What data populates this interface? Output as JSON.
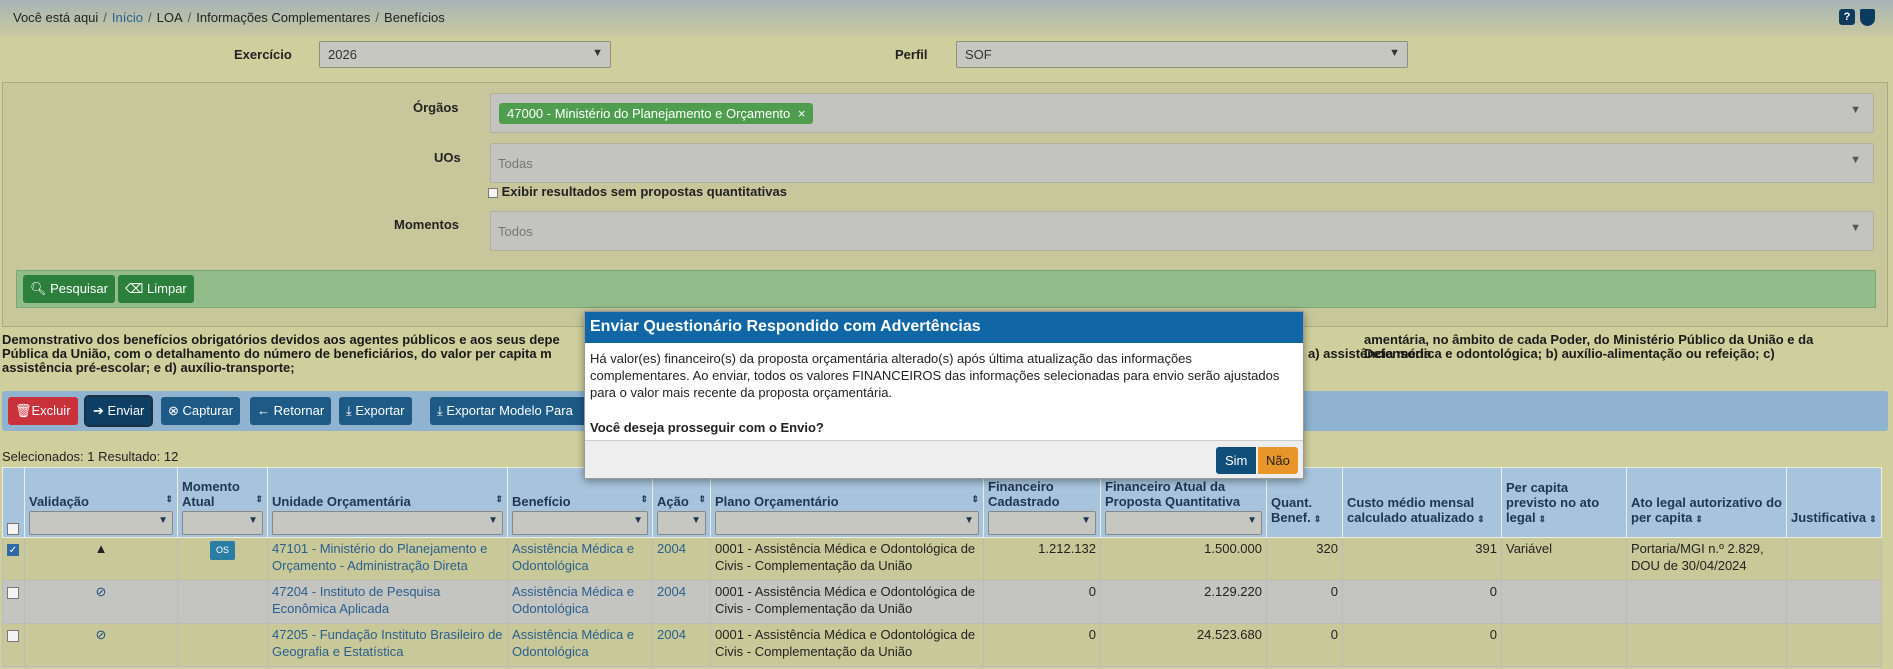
{
  "breadcrumb": {
    "prefix": "Você está aqui",
    "items": [
      "Início",
      "LOA",
      "Informações Complementares",
      "Benefícios"
    ]
  },
  "top_icons": {
    "help": "?",
    "shield": "shield-icon"
  },
  "filters": {
    "exercicio_label": "Exercício",
    "exercicio_value": "2026",
    "perfil_label": "Perfil",
    "perfil_value": "SOF",
    "orgaos_label": "Órgãos",
    "orgaos_tag": "47000 - Ministério do Planejamento e Orçamento",
    "uos_label": "UOs",
    "uos_placeholder": "Todas",
    "exibir_label": "Exibir resultados sem propostas quantitativas",
    "momentos_label": "Momentos",
    "momentos_placeholder": "Todos",
    "pesquisar": "Pesquisar",
    "limpar": "Limpar"
  },
  "description": {
    "line1a": "Demonstrativo dos benefícios obrigatórios devidos aos agentes públicos e aos seus depe",
    "line1b": "amentária, no âmbito de cada Poder, do Ministério Público da União e da Defensoria",
    "line2a": "Pública da União, com o detalhamento do número de beneficiários, do valor per capita m",
    "line2b": "a) assistência médica e odontológica; b) auxílio-alimentação ou refeição; c)",
    "line3": "assistência pré-escolar; e d) auxílio-transporte;"
  },
  "toolbar": {
    "excluir": "Excluir",
    "enviar": "Enviar",
    "capturar": "Capturar",
    "retornar": "Retornar",
    "exportar": "Exportar",
    "exportar_modelo": "Exportar Modelo Para"
  },
  "selection_info": "Selecionados: 1 Resultado: 12",
  "table": {
    "headers": {
      "validacao": "Validação",
      "momento": "Momento Atual",
      "uo": "Unidade Orçamentária",
      "beneficio": "Benefício",
      "acao": "Ação",
      "plano": "Plano Orçamentário",
      "fin_cad": "Financeiro Cadastrado",
      "fin_atual": "Financeiro Atual da Proposta Quantitativa",
      "quant": "Quant. Benef.",
      "custo": "Custo médio mensal calculado atualizado",
      "percapita": "Per capita previsto no ato legal",
      "ato": "Ato legal autorizativo do per capita",
      "just": "Justificativa"
    },
    "rows": [
      {
        "checked": true,
        "validacao_icon": "warning-icon",
        "momento": "OS",
        "uo": "47101 - Ministério do Planejamento e Orçamento - Administração Direta",
        "beneficio": "Assistência Médica e Odontológica",
        "acao": "2004",
        "plano": "0001 - Assistência Médica e Odontológica de Civis - Complementação da União",
        "fin_cad": "1.212.132",
        "fin_atual": "1.500.000",
        "quant": "320",
        "custo": "391",
        "percapita": "Variável",
        "ato": "Portaria/MGI n.º 2.829, DOU de 30/04/2024"
      },
      {
        "checked": false,
        "validacao_icon": "blocked-icon",
        "momento": "",
        "uo": "47204 - Instituto de Pesquisa Econômica Aplicada",
        "beneficio": "Assistência Médica e Odontológica",
        "acao": "2004",
        "plano": "0001 - Assistência Médica e Odontológica de Civis - Complementação da União",
        "fin_cad": "0",
        "fin_atual": "2.129.220",
        "quant": "0",
        "custo": "0",
        "percapita": "",
        "ato": ""
      },
      {
        "checked": false,
        "validacao_icon": "blocked-icon",
        "momento": "",
        "uo": "47205 - Fundação Instituto Brasileiro de Geografia e Estatística",
        "beneficio": "Assistência Médica e Odontológica",
        "acao": "2004",
        "plano": "0001 - Assistência Médica e Odontológica de Civis - Complementação da União",
        "fin_cad": "0",
        "fin_atual": "24.523.680",
        "quant": "0",
        "custo": "0",
        "percapita": "",
        "ato": ""
      }
    ]
  },
  "modal": {
    "title": "Enviar Questionário Respondido com Advertências",
    "body": "Há valor(es) financeiro(s) da proposta orçamentária alterado(s) após última atualização das informações complementares. Ao enviar, todos os valores FINANCEIROS das informações selecionadas para envio serão ajustados para o valor mais recente da proposta orçamentária.",
    "question": "Você deseja prosseguir com o Envio?",
    "yes": "Sim",
    "no": "Não"
  },
  "colors": {
    "modal_header": "#1166a5",
    "yes_button": "#0e4e78",
    "no_button": "#e8962a",
    "tag": "#4f9e4f"
  }
}
